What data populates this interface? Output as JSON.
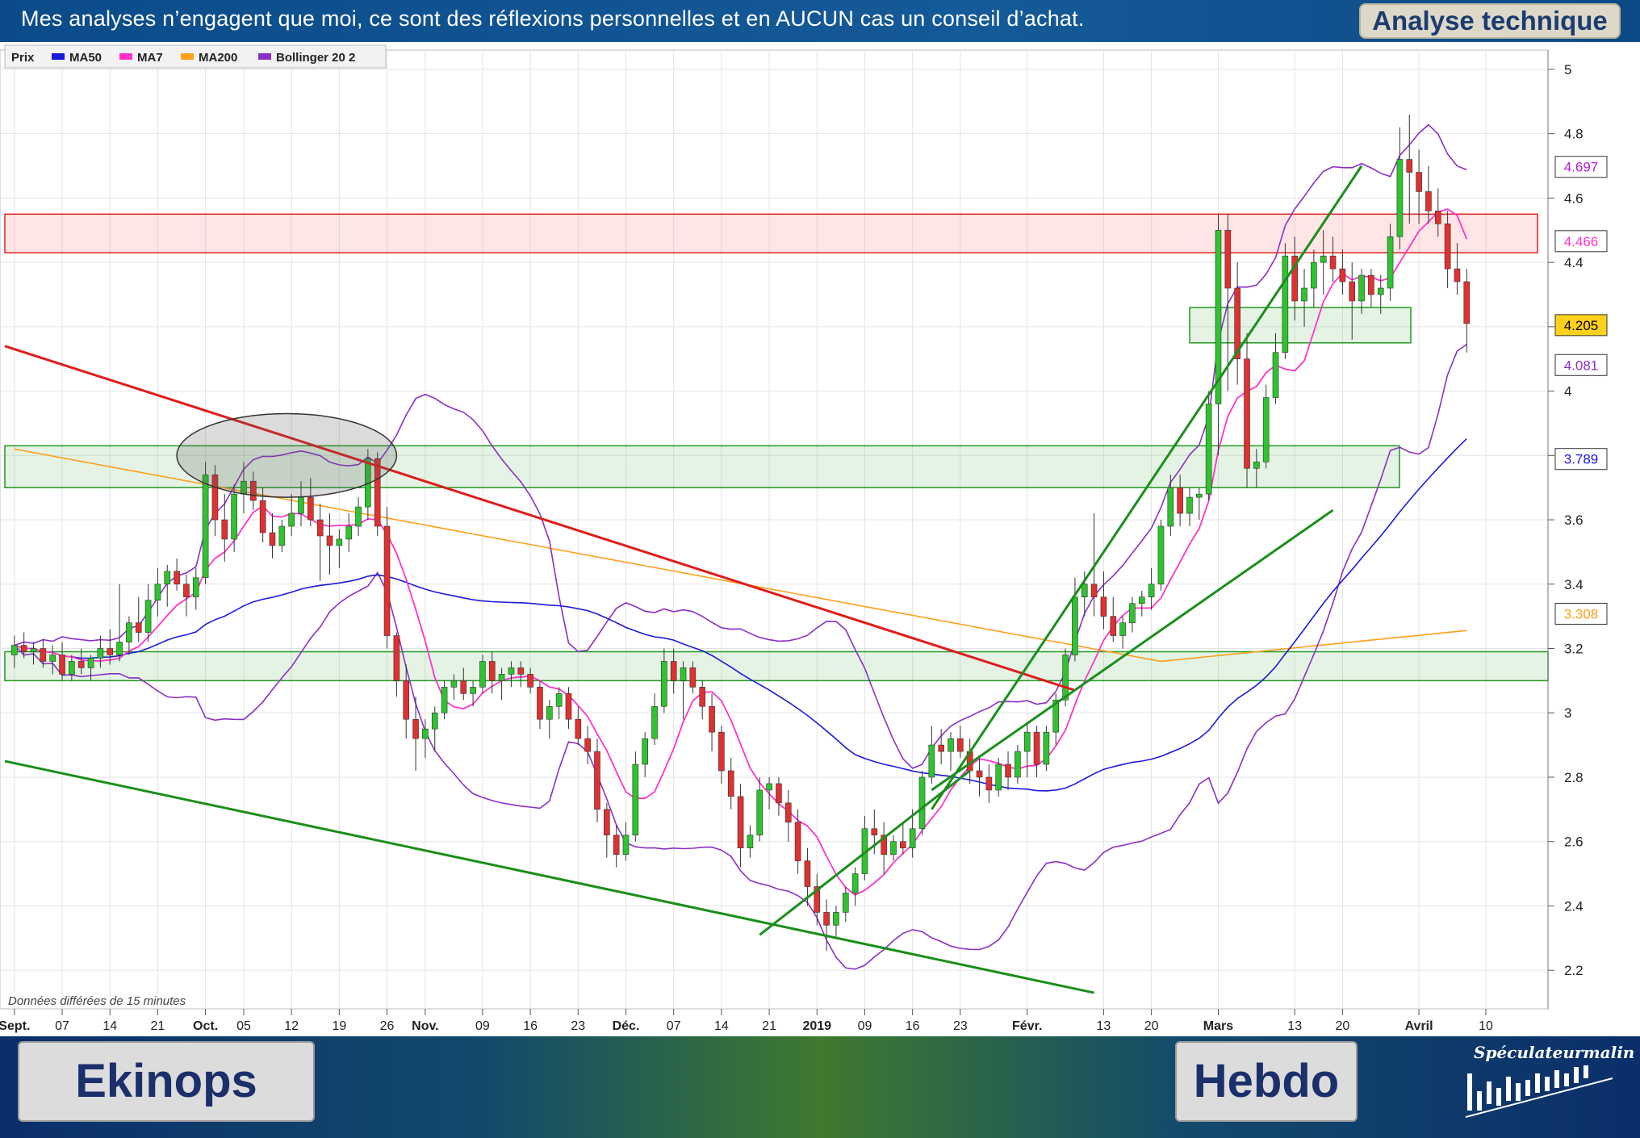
{
  "header": {
    "disclaimer": "Mes analyses n’engagent que moi, ce sont des réflexions personnelles  et en AUCUN cas un conseil d’achat.",
    "tag": "Analyse technique"
  },
  "footer": {
    "stock_name": "Ekinops",
    "timeframe": "Hebdo",
    "logo_text": "Spéculateurmalin"
  },
  "legend": {
    "items": [
      {
        "label": "Prix",
        "color": ""
      },
      {
        "label": "MA50",
        "color": "#1a1ad9"
      },
      {
        "label": "MA7",
        "color": "#ff33cc"
      },
      {
        "label": "MA200",
        "color": "#ff9f1a"
      },
      {
        "label": "Bollinger 20 2",
        "color": "#8b2fc9"
      }
    ]
  },
  "delay_note": "Données différées de 15 minutes",
  "price_labels": [
    {
      "value": 4.697,
      "text": "4.697",
      "color": "#b21fd6",
      "bg": "#ffffff"
    },
    {
      "value": 4.466,
      "text": "4.466",
      "color": "#ff33cc",
      "bg": "#ffffff"
    },
    {
      "value": 4.205,
      "text": "4.205",
      "color": "#000000",
      "bg": "#ffd11a"
    },
    {
      "value": 4.081,
      "text": "4.081",
      "color": "#8b2fc9",
      "bg": "#ffffff"
    },
    {
      "value": 3.789,
      "text": "3.789",
      "color": "#1a1ad9",
      "bg": "#ffffff"
    },
    {
      "value": 3.308,
      "text": "3.308",
      "color": "#ff9f1a",
      "bg": "#ffffff"
    }
  ],
  "chart_data": {
    "type": "candlestick",
    "ylim": [
      2.08,
      5.06
    ],
    "y_ticks": [
      2.2,
      2.4,
      2.6,
      2.8,
      3,
      3.2,
      3.4,
      3.6,
      3.8,
      4,
      4.2,
      4.4,
      4.6,
      4.8,
      5
    ],
    "y_tick_labels": [
      "2.2",
      "2.4",
      "2.6",
      "2.8",
      "3",
      "3.2",
      "3.4",
      "3.6",
      "3.8",
      "4",
      "4.2",
      "4.4",
      "4.6",
      "4.8",
      "5"
    ],
    "x_ticks": [
      {
        "label": "Sept.",
        "day": 0,
        "bold": true
      },
      {
        "label": "07",
        "day": 5,
        "bold": false
      },
      {
        "label": "14",
        "day": 10,
        "bold": false
      },
      {
        "label": "21",
        "day": 15,
        "bold": false
      },
      {
        "label": "Oct.",
        "day": 20,
        "bold": true
      },
      {
        "label": "05",
        "day": 24,
        "bold": false
      },
      {
        "label": "12",
        "day": 29,
        "bold": false
      },
      {
        "label": "19",
        "day": 34,
        "bold": false
      },
      {
        "label": "26",
        "day": 39,
        "bold": false
      },
      {
        "label": "Nov.",
        "day": 43,
        "bold": true
      },
      {
        "label": "09",
        "day": 49,
        "bold": false
      },
      {
        "label": "16",
        "day": 54,
        "bold": false
      },
      {
        "label": "23",
        "day": 59,
        "bold": false
      },
      {
        "label": "Déc.",
        "day": 64,
        "bold": true
      },
      {
        "label": "07",
        "day": 69,
        "bold": false
      },
      {
        "label": "14",
        "day": 74,
        "bold": false
      },
      {
        "label": "21",
        "day": 79,
        "bold": false
      },
      {
        "label": "2019",
        "day": 84,
        "bold": true
      },
      {
        "label": "09",
        "day": 89,
        "bold": false
      },
      {
        "label": "16",
        "day": 94,
        "bold": false
      },
      {
        "label": "23",
        "day": 99,
        "bold": false
      },
      {
        "label": "Févr.",
        "day": 106,
        "bold": true
      },
      {
        "label": "13",
        "day": 114,
        "bold": false
      },
      {
        "label": "20",
        "day": 119,
        "bold": false
      },
      {
        "label": "Mars",
        "day": 126,
        "bold": true
      },
      {
        "label": "13",
        "day": 134,
        "bold": false
      },
      {
        "label": "20",
        "day": 139,
        "bold": false
      },
      {
        "label": "Avril",
        "day": 147,
        "bold": true
      },
      {
        "label": "10",
        "day": 154,
        "bold": false
      }
    ],
    "x_range": [
      -1,
      160
    ],
    "candles": [
      [
        3.18,
        3.24,
        3.14,
        3.21
      ],
      [
        3.21,
        3.25,
        3.17,
        3.19
      ],
      [
        3.19,
        3.22,
        3.15,
        3.2
      ],
      [
        3.2,
        3.23,
        3.14,
        3.16
      ],
      [
        3.16,
        3.21,
        3.12,
        3.18
      ],
      [
        3.18,
        3.22,
        3.1,
        3.12
      ],
      [
        3.12,
        3.18,
        3.1,
        3.16
      ],
      [
        3.16,
        3.2,
        3.12,
        3.14
      ],
      [
        3.14,
        3.18,
        3.1,
        3.17
      ],
      [
        3.17,
        3.24,
        3.14,
        3.2
      ],
      [
        3.2,
        3.26,
        3.15,
        3.18
      ],
      [
        3.18,
        3.4,
        3.16,
        3.22
      ],
      [
        3.22,
        3.3,
        3.18,
        3.28
      ],
      [
        3.28,
        3.36,
        3.22,
        3.25
      ],
      [
        3.25,
        3.4,
        3.22,
        3.35
      ],
      [
        3.35,
        3.45,
        3.3,
        3.4
      ],
      [
        3.4,
        3.46,
        3.33,
        3.44
      ],
      [
        3.44,
        3.48,
        3.38,
        3.4
      ],
      [
        3.4,
        3.43,
        3.3,
        3.36
      ],
      [
        3.36,
        3.45,
        3.32,
        3.42
      ],
      [
        3.42,
        3.78,
        3.4,
        3.74
      ],
      [
        3.74,
        3.77,
        3.55,
        3.6
      ],
      [
        3.6,
        3.68,
        3.47,
        3.54
      ],
      [
        3.54,
        3.71,
        3.5,
        3.68
      ],
      [
        3.68,
        3.78,
        3.62,
        3.72
      ],
      [
        3.72,
        3.75,
        3.63,
        3.66
      ],
      [
        3.66,
        3.7,
        3.53,
        3.56
      ],
      [
        3.56,
        3.62,
        3.48,
        3.52
      ],
      [
        3.52,
        3.6,
        3.5,
        3.58
      ],
      [
        3.58,
        3.68,
        3.55,
        3.62
      ],
      [
        3.62,
        3.72,
        3.58,
        3.67
      ],
      [
        3.67,
        3.73,
        3.58,
        3.6
      ],
      [
        3.6,
        3.65,
        3.41,
        3.55
      ],
      [
        3.55,
        3.62,
        3.43,
        3.52
      ],
      [
        3.52,
        3.57,
        3.45,
        3.54
      ],
      [
        3.54,
        3.62,
        3.5,
        3.58
      ],
      [
        3.58,
        3.67,
        3.55,
        3.64
      ],
      [
        3.64,
        3.82,
        3.6,
        3.79
      ],
      [
        3.79,
        3.81,
        3.55,
        3.58
      ],
      [
        3.58,
        3.64,
        3.2,
        3.24
      ],
      [
        3.24,
        3.25,
        3.05,
        3.1
      ],
      [
        3.1,
        3.15,
        2.92,
        2.98
      ],
      [
        2.98,
        3.05,
        2.82,
        2.92
      ],
      [
        2.92,
        2.98,
        2.86,
        2.95
      ],
      [
        2.95,
        3.02,
        2.88,
        3.0
      ],
      [
        3.0,
        3.1,
        2.98,
        3.08
      ],
      [
        3.08,
        3.12,
        3.04,
        3.1
      ],
      [
        3.1,
        3.14,
        3.04,
        3.06
      ],
      [
        3.06,
        3.1,
        3.02,
        3.08
      ],
      [
        3.08,
        3.18,
        3.06,
        3.16
      ],
      [
        3.16,
        3.19,
        3.06,
        3.1
      ],
      [
        3.1,
        3.14,
        3.04,
        3.12
      ],
      [
        3.12,
        3.16,
        3.08,
        3.14
      ],
      [
        3.14,
        3.16,
        3.08,
        3.12
      ],
      [
        3.12,
        3.14,
        3.06,
        3.08
      ],
      [
        3.08,
        3.1,
        2.95,
        2.98
      ],
      [
        2.98,
        3.04,
        2.92,
        3.02
      ],
      [
        3.02,
        3.08,
        2.98,
        3.06
      ],
      [
        3.06,
        3.08,
        2.95,
        2.98
      ],
      [
        2.98,
        3.02,
        2.9,
        2.92
      ],
      [
        2.92,
        2.96,
        2.84,
        2.88
      ],
      [
        2.88,
        2.92,
        2.66,
        2.7
      ],
      [
        2.7,
        2.72,
        2.55,
        2.62
      ],
      [
        2.62,
        2.65,
        2.52,
        2.56
      ],
      [
        2.56,
        2.66,
        2.54,
        2.62
      ],
      [
        2.62,
        2.88,
        2.6,
        2.84
      ],
      [
        2.84,
        2.94,
        2.8,
        2.92
      ],
      [
        2.92,
        3.06,
        2.9,
        3.02
      ],
      [
        3.02,
        3.2,
        3.0,
        3.16
      ],
      [
        3.16,
        3.2,
        3.06,
        3.1
      ],
      [
        3.1,
        3.16,
        2.98,
        3.14
      ],
      [
        3.14,
        3.16,
        3.06,
        3.08
      ],
      [
        3.08,
        3.1,
        2.98,
        3.02
      ],
      [
        3.02,
        3.06,
        2.88,
        2.94
      ],
      [
        2.94,
        2.96,
        2.78,
        2.82
      ],
      [
        2.82,
        2.86,
        2.7,
        2.74
      ],
      [
        2.74,
        2.78,
        2.52,
        2.58
      ],
      [
        2.58,
        2.65,
        2.55,
        2.62
      ],
      [
        2.62,
        2.8,
        2.6,
        2.76
      ],
      [
        2.76,
        2.8,
        2.7,
        2.78
      ],
      [
        2.78,
        2.8,
        2.68,
        2.72
      ],
      [
        2.72,
        2.76,
        2.6,
        2.66
      ],
      [
        2.66,
        2.7,
        2.5,
        2.54
      ],
      [
        2.54,
        2.58,
        2.4,
        2.46
      ],
      [
        2.46,
        2.5,
        2.34,
        2.38
      ],
      [
        2.38,
        2.42,
        2.26,
        2.34
      ],
      [
        2.34,
        2.4,
        2.3,
        2.38
      ],
      [
        2.38,
        2.46,
        2.35,
        2.44
      ],
      [
        2.44,
        2.52,
        2.4,
        2.5
      ],
      [
        2.5,
        2.68,
        2.48,
        2.64
      ],
      [
        2.64,
        2.7,
        2.56,
        2.62
      ],
      [
        2.62,
        2.66,
        2.5,
        2.56
      ],
      [
        2.56,
        2.62,
        2.54,
        2.6
      ],
      [
        2.6,
        2.66,
        2.56,
        2.58
      ],
      [
        2.58,
        2.7,
        2.55,
        2.64
      ],
      [
        2.64,
        2.82,
        2.62,
        2.8
      ],
      [
        2.8,
        2.96,
        2.78,
        2.9
      ],
      [
        2.9,
        2.95,
        2.84,
        2.88
      ],
      [
        2.88,
        2.94,
        2.82,
        2.92
      ],
      [
        2.92,
        2.96,
        2.86,
        2.88
      ],
      [
        2.88,
        2.92,
        2.78,
        2.82
      ],
      [
        2.82,
        2.86,
        2.74,
        2.8
      ],
      [
        2.8,
        2.84,
        2.72,
        2.76
      ],
      [
        2.76,
        2.86,
        2.74,
        2.84
      ],
      [
        2.84,
        2.88,
        2.76,
        2.8
      ],
      [
        2.8,
        2.9,
        2.78,
        2.88
      ],
      [
        2.88,
        2.97,
        2.8,
        2.94
      ],
      [
        2.94,
        2.96,
        2.8,
        2.84
      ],
      [
        2.84,
        2.96,
        2.82,
        2.94
      ],
      [
        2.94,
        3.06,
        2.9,
        3.04
      ],
      [
        3.04,
        3.2,
        3.02,
        3.18
      ],
      [
        3.18,
        3.42,
        3.16,
        3.36
      ],
      [
        3.36,
        3.44,
        3.3,
        3.4
      ],
      [
        3.4,
        3.62,
        3.3,
        3.36
      ],
      [
        3.36,
        3.44,
        3.26,
        3.3
      ],
      [
        3.3,
        3.36,
        3.22,
        3.24
      ],
      [
        3.24,
        3.3,
        3.2,
        3.28
      ],
      [
        3.28,
        3.36,
        3.25,
        3.34
      ],
      [
        3.34,
        3.38,
        3.3,
        3.36
      ],
      [
        3.36,
        3.45,
        3.32,
        3.4
      ],
      [
        3.4,
        3.6,
        3.38,
        3.58
      ],
      [
        3.58,
        3.74,
        3.55,
        3.7
      ],
      [
        3.7,
        3.74,
        3.58,
        3.62
      ],
      [
        3.62,
        3.7,
        3.58,
        3.67
      ],
      [
        3.67,
        3.7,
        3.6,
        3.68
      ],
      [
        3.68,
        4.0,
        3.66,
        3.96
      ],
      [
        3.96,
        4.55,
        3.8,
        4.5
      ],
      [
        4.5,
        4.55,
        4.0,
        4.32
      ],
      [
        4.32,
        4.4,
        4.02,
        4.1
      ],
      [
        4.1,
        4.18,
        3.7,
        3.76
      ],
      [
        3.76,
        3.82,
        3.7,
        3.78
      ],
      [
        3.78,
        4.02,
        3.76,
        3.98
      ],
      [
        3.98,
        4.18,
        3.96,
        4.12
      ],
      [
        4.12,
        4.46,
        4.1,
        4.42
      ],
      [
        4.42,
        4.48,
        4.22,
        4.28
      ],
      [
        4.28,
        4.38,
        4.2,
        4.32
      ],
      [
        4.32,
        4.44,
        4.26,
        4.4
      ],
      [
        4.4,
        4.5,
        4.3,
        4.42
      ],
      [
        4.42,
        4.48,
        4.34,
        4.38
      ],
      [
        4.38,
        4.44,
        4.3,
        4.34
      ],
      [
        4.34,
        4.4,
        4.16,
        4.28
      ],
      [
        4.28,
        4.38,
        4.24,
        4.36
      ],
      [
        4.36,
        4.38,
        4.26,
        4.3
      ],
      [
        4.3,
        4.36,
        4.24,
        4.32
      ],
      [
        4.32,
        4.52,
        4.28,
        4.48
      ],
      [
        4.48,
        4.82,
        4.44,
        4.72
      ],
      [
        4.72,
        4.86,
        4.52,
        4.68
      ],
      [
        4.68,
        4.75,
        4.52,
        4.62
      ],
      [
        4.62,
        4.7,
        4.52,
        4.56
      ],
      [
        4.56,
        4.63,
        4.48,
        4.52
      ],
      [
        4.52,
        4.56,
        4.32,
        4.38
      ],
      [
        4.38,
        4.46,
        4.3,
        4.34
      ],
      [
        4.34,
        4.38,
        4.12,
        4.21
      ]
    ],
    "support_zones": [
      {
        "y1": 4.43,
        "y2": 4.55,
        "color": "red"
      },
      {
        "y1": 4.15,
        "y2": 4.26,
        "color": "green"
      },
      {
        "y1": 3.7,
        "y2": 3.83,
        "color": "green"
      },
      {
        "y1": 3.1,
        "y2": 3.19,
        "color": "green"
      }
    ]
  }
}
